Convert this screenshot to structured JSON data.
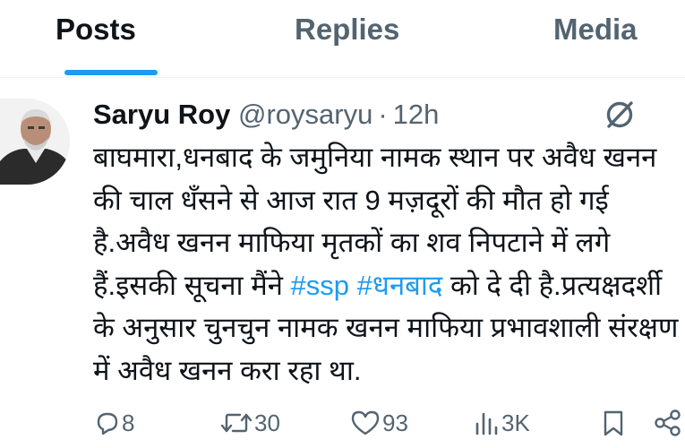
{
  "tabs": [
    {
      "label": "Posts",
      "active": true
    },
    {
      "label": "Replies",
      "active": false
    },
    {
      "label": "Media",
      "active": false
    }
  ],
  "tweet": {
    "author_name": "Saryu Roy",
    "handle": "@roysaryu",
    "separator": "·",
    "time": "12h",
    "lines": [
      "बाघमारा,धनबाद के जमुनिया नामक स्थान पर अवैध खनन",
      "की चाल धँसने से आज रात 9 मज़दूरों की मौत हो गई",
      "है.अवैध खनन माफिया मृतकों का शव निपटाने में लगे"
    ],
    "line4_before": "हैं.इसकी सूचना मैंने ",
    "hashtag1": "#ssp",
    "hashtag2": "#धनबाद",
    "line4_after": " को दे दी है.प्रत्यक्षदर्शी",
    "line5": "के अनुसार चुनचुन नामक खनन माफिया प्रभावशाली संरक्षण",
    "line6": "में अवैध खनन करा रहा था."
  },
  "actions": {
    "replies": "8",
    "reposts": "30",
    "likes": "93",
    "views": "3K"
  },
  "icons": {
    "grok": "grok-icon",
    "reply": "reply-icon",
    "repost": "repost-icon",
    "like": "heart-icon",
    "views": "views-icon",
    "bookmark": "bookmark-icon",
    "share": "share-icon"
  },
  "colors": {
    "accent": "#1d9bf0",
    "text": "#0f1419",
    "muted": "#536471"
  }
}
